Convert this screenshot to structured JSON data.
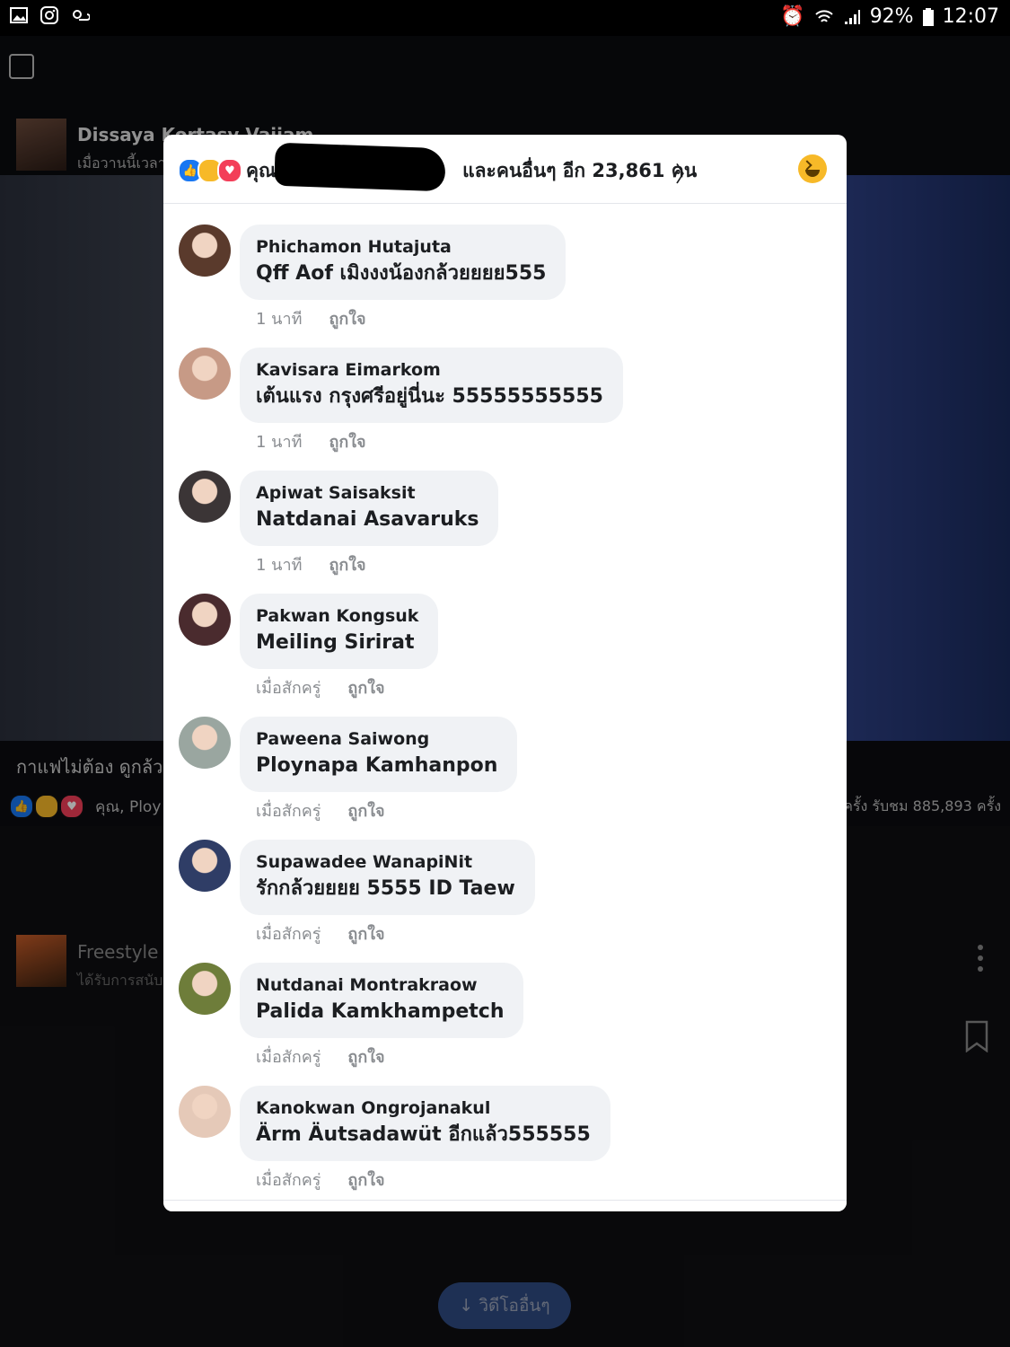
{
  "status_bar": {
    "battery": "92%",
    "time": "12:07"
  },
  "background": {
    "post_name": "Dissaya Kortasy Vajiam",
    "post_time": "เมื่อวานนี้เวลา",
    "caption": "กาแฟไม่ต้อง ดูกล้วย",
    "reactions_text": "คุณ, Ploy Plo",
    "views_text": "ครั้ง รับชม 885,893 ครั้ง",
    "ad_name": "Freestyle N",
    "ad_sub": "ได้รับการสนับ",
    "more_videos_label": "วิดีโออื่นๆ"
  },
  "modal": {
    "reactors_prefix": "คุณ,",
    "reactors_suffix": "และคนอื่นๆ อีก 23,861 คน",
    "comments": [
      {
        "name": "Phichamon Hutajuta",
        "text": "Qff Aof เมิงงงน้องกล้วยยยย555",
        "time": "1 นาที",
        "like": "ถูกใจ",
        "avatar_color": "#5a3a2c"
      },
      {
        "name": "Kavisara Eimarkom",
        "text": "เต้นแรง กรุงศรีอยู่นี่นะ 55555555555",
        "time": "1 นาที",
        "like": "ถูกใจ",
        "avatar_color": "#c79a86"
      },
      {
        "name": "Apiwat Saisaksit",
        "text": "Natdanai Asavaruks",
        "time": "1 นาที",
        "like": "ถูกใจ",
        "avatar_color": "#3b3536"
      },
      {
        "name": "Pakwan Kongsuk",
        "text": "Meiling Sirirat",
        "time": "เมื่อสักครู่",
        "like": "ถูกใจ",
        "avatar_color": "#4a2b2e"
      },
      {
        "name": "Paweena Saiwong",
        "text": "Ploynapa Kamhanpon",
        "time": "เมื่อสักครู่",
        "like": "ถูกใจ",
        "avatar_color": "#9aa6a0"
      },
      {
        "name": "Supawadee WanapiNit",
        "text": "รักกล้วยยยย 5555 ID Taew",
        "time": "เมื่อสักครู่",
        "like": "ถูกใจ",
        "avatar_color": "#2f3d66"
      },
      {
        "name": "Nutdanai Montrakraow",
        "text": "Palida Kamkhampetch",
        "time": "เมื่อสักครู่",
        "like": "ถูกใจ",
        "avatar_color": "#6e7d3a"
      },
      {
        "name": "Kanokwan Ongrojanakul",
        "text": "Ärm Äutsadawüt อีกแล้ว555555",
        "time": "เมื่อสักครู่",
        "like": "ถูกใจ",
        "avatar_color": "#e5c9b8"
      }
    ]
  }
}
